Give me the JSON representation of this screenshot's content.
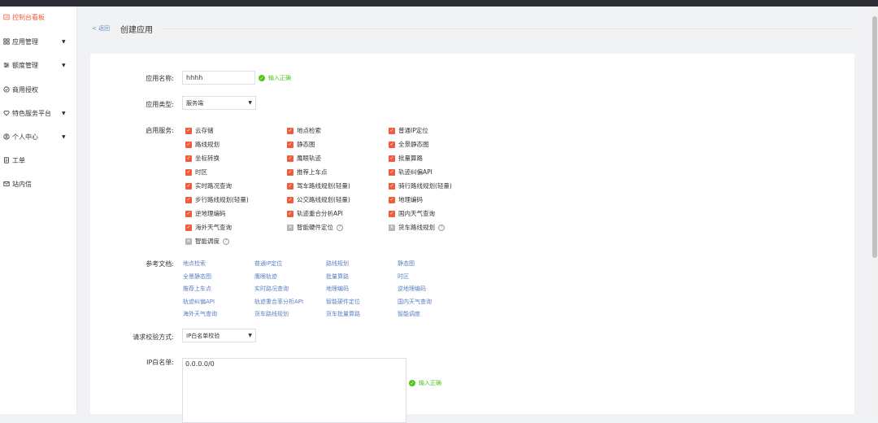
{
  "sidebar": {
    "items": [
      {
        "label": "控制台看板",
        "icon": "dashboard-icon",
        "active": true,
        "arrow": ""
      },
      {
        "label": "应用管理",
        "icon": "grid-icon",
        "active": false,
        "arrow": "▼"
      },
      {
        "label": "额度管理",
        "icon": "sliders-icon",
        "active": false,
        "arrow": "▼"
      },
      {
        "label": "商用授权",
        "icon": "shield-icon",
        "active": false,
        "arrow": ""
      },
      {
        "label": "特色服务平台",
        "icon": "heart-icon",
        "active": false,
        "arrow": "▼"
      },
      {
        "label": "个人中心",
        "icon": "user-icon",
        "active": false,
        "arrow": "▼"
      },
      {
        "label": "工单",
        "icon": "ticket-icon",
        "active": false,
        "arrow": ""
      },
      {
        "label": "站内信",
        "icon": "mail-icon",
        "active": false,
        "arrow": ""
      }
    ]
  },
  "header": {
    "back_label": "< 返回",
    "title": "创建应用"
  },
  "form": {
    "app_name": {
      "label": "应用名称:",
      "value": "hhhh",
      "valid_text": "输入正确"
    },
    "app_type": {
      "label": "应用类型:",
      "value": "服务端"
    },
    "services_label": "启用服务:",
    "services": [
      {
        "label": "云存储",
        "checked": true,
        "help": false
      },
      {
        "label": "地点检索",
        "checked": true,
        "help": false
      },
      {
        "label": "普通IP定位",
        "checked": true,
        "help": false
      },
      {
        "label": "路线规划",
        "checked": true,
        "help": false
      },
      {
        "label": "静态图",
        "checked": true,
        "help": false
      },
      {
        "label": "全景静态图",
        "checked": true,
        "help": false
      },
      {
        "label": "坐标转换",
        "checked": true,
        "help": false
      },
      {
        "label": "鹰眼轨迹",
        "checked": true,
        "help": false
      },
      {
        "label": "批量算路",
        "checked": true,
        "help": false
      },
      {
        "label": "时区",
        "checked": true,
        "help": false
      },
      {
        "label": "推荐上车点",
        "checked": true,
        "help": false
      },
      {
        "label": "轨迹纠偏API",
        "checked": true,
        "help": false
      },
      {
        "label": "实时路况查询",
        "checked": true,
        "help": false
      },
      {
        "label": "驾车路线规划(轻量)",
        "checked": true,
        "help": false
      },
      {
        "label": "骑行路线规划(轻量)",
        "checked": true,
        "help": false
      },
      {
        "label": "步行路线规划(轻量)",
        "checked": true,
        "help": false
      },
      {
        "label": "公交路线规划(轻量)",
        "checked": true,
        "help": false
      },
      {
        "label": "地理编码",
        "checked": true,
        "help": false
      },
      {
        "label": "逆地理编码",
        "checked": true,
        "help": false
      },
      {
        "label": "轨迹重合分析API",
        "checked": true,
        "help": false
      },
      {
        "label": "国内天气查询",
        "checked": true,
        "help": false
      },
      {
        "label": "海外天气查询",
        "checked": true,
        "help": false
      },
      {
        "label": "智能硬件定位",
        "checked": false,
        "help": true
      },
      {
        "label": "货车路线规划",
        "checked": false,
        "help": true
      },
      {
        "label": "智能调度",
        "checked": false,
        "help": true
      }
    ],
    "docs_label": "参考文档:",
    "docs": [
      "地点检索",
      "普通IP定位",
      "路线规划",
      "静态图",
      "全景静态图",
      "鹰眼轨迹",
      "批量算路",
      "时区",
      "推荐上车点",
      "实时路况查询",
      "地理编码",
      "逆地理编码",
      "轨迹纠偏API",
      "轨迹重合率分析API",
      "智能硬件定位",
      "国内天气查询",
      "海外天气查询",
      "货车路线规划",
      "货车批量算路",
      "智能调度"
    ],
    "verify": {
      "label": "请求校验方式:",
      "value": "IP白名单校验"
    },
    "whitelist": {
      "label": "IP白名单:",
      "value": "0.0.0.0/0",
      "valid_text": "输入正确"
    }
  },
  "colors": {
    "accent": "#f35a39",
    "link": "#5b7fc3",
    "success": "#52c41a"
  }
}
